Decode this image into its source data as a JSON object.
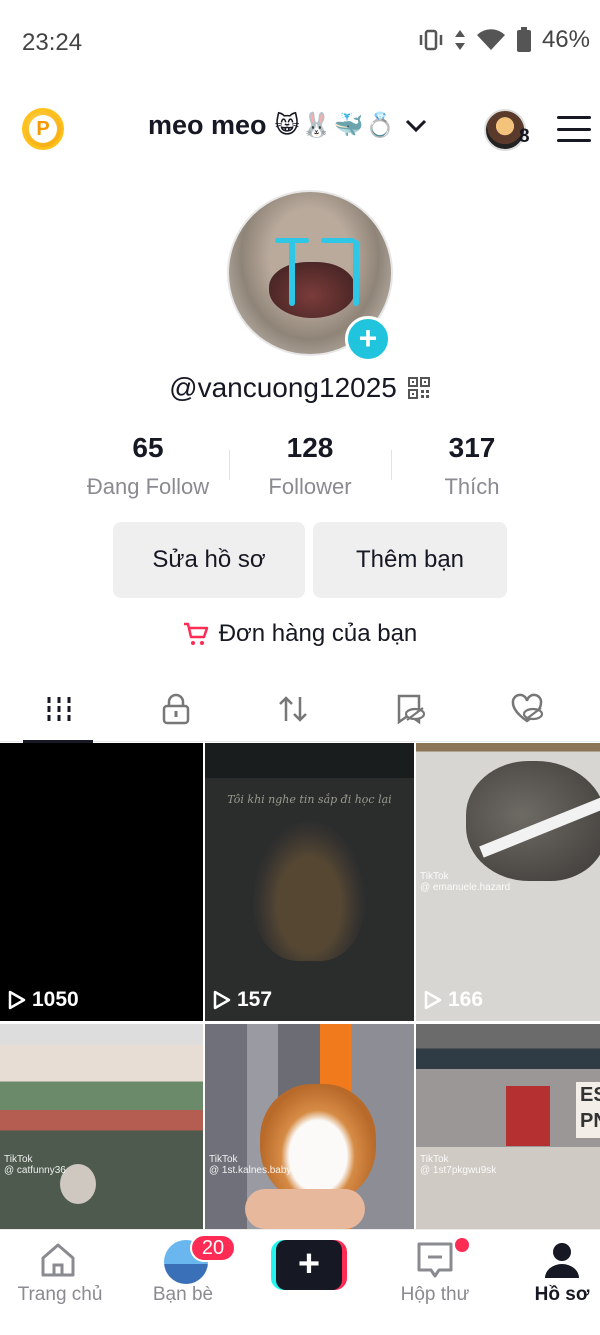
{
  "status_bar": {
    "time": "23:24",
    "battery": "46%"
  },
  "top_bar": {
    "account_name": "meo meo",
    "account_emojis": "😸🐰🐳💍",
    "switch_count": "8"
  },
  "profile": {
    "username": "@vancuong12025",
    "stats": [
      {
        "value": "65",
        "label": "Đang Follow"
      },
      {
        "value": "128",
        "label": "Follower"
      },
      {
        "value": "317",
        "label": "Thích"
      }
    ],
    "edit_profile_label": "Sửa hồ sơ",
    "add_friend_label": "Thêm bạn",
    "orders_label": "Đơn hàng của bạn"
  },
  "tabs": [
    {
      "name": "videos",
      "icon": "grid-icon",
      "active": true
    },
    {
      "name": "private",
      "icon": "lock-icon",
      "active": false
    },
    {
      "name": "reposts",
      "icon": "repost-icon",
      "active": false
    },
    {
      "name": "saved",
      "icon": "bookmark-hidden-icon",
      "active": false
    },
    {
      "name": "liked",
      "icon": "heart-hidden-icon",
      "active": false
    }
  ],
  "videos": [
    {
      "views": "1050",
      "caption": ""
    },
    {
      "views": "157",
      "caption": "Tôi khi nghe tin sắp đi học lại"
    },
    {
      "views": "166",
      "caption": "",
      "watermark": "TikTok",
      "watermark_user": "@ emanuele.hazard"
    },
    {
      "views": "",
      "caption": "",
      "watermark": "TikTok",
      "watermark_user": "@ catfunny36"
    },
    {
      "views": "",
      "caption": "",
      "watermark": "TikTok",
      "watermark_user": "@ 1st.kalnes.baby"
    },
    {
      "views": "",
      "caption": "",
      "watermark": "TikTok",
      "watermark_user": "@ 1st7pkgwu9sk",
      "sign_text": "ES\nPN"
    }
  ],
  "bottom_nav": {
    "home": "Trang chủ",
    "friends": "Bạn bè",
    "friends_badge": "20",
    "create": "+",
    "inbox": "Hộp thư",
    "profile": "Hồ sơ"
  },
  "colors": {
    "accent_pink": "#fe2c55",
    "accent_cyan": "#25f4ee",
    "text_primary": "#161823",
    "text_secondary": "#8a8b91"
  }
}
